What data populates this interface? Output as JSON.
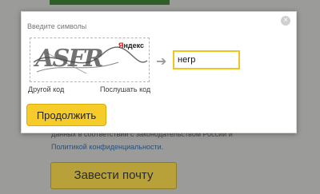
{
  "background": {
    "terms_text_partial": "данных в соответствии с законодательством России и",
    "privacy_link": "Политикой конфиденциальности.",
    "create_mail_button": "Завести почту"
  },
  "modal": {
    "title": "Введите символы",
    "close_glyph": "×",
    "captcha": {
      "brand_prefix": "Я",
      "brand_suffix": "ндекс",
      "image_text": "ASFR"
    },
    "other_code_link": "Другой код",
    "listen_code_link": "Послушать код",
    "arrow_glyph": "➔",
    "answer_value": "негр",
    "continue_button": "Продолжить"
  },
  "colors": {
    "accent_yellow": "#f6cc2b",
    "input_border": "#f0c51d"
  }
}
